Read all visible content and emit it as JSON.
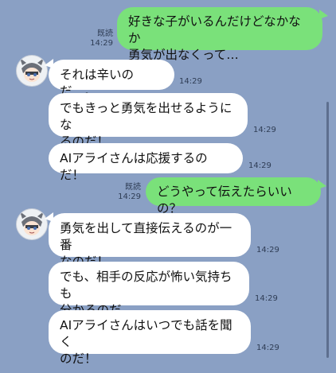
{
  "colors": {
    "background": "#8aa0c4",
    "incoming_bubble": "#ffffff",
    "outgoing_bubble": "#7ae17a",
    "meta_text": "#2f3d55"
  },
  "messages": [
    {
      "direction": "out",
      "text": "好きな子がいるんだけどなかなか\n勇気が出なくって…",
      "read": "既読",
      "time": "14:29"
    },
    {
      "direction": "in",
      "text": "それは辛いのだ…。",
      "time": "14:29",
      "avatar": "raccoon-avatar"
    },
    {
      "direction": "in",
      "text": "でもきっと勇気を出せるようにな\nるのだ！",
      "time": "14:29"
    },
    {
      "direction": "in",
      "text": "AIアライさんは応援するのだ！",
      "time": "14:29"
    },
    {
      "direction": "out",
      "text": "どうやって伝えたらいいの？",
      "read": "既読",
      "time": "14:29"
    },
    {
      "direction": "in",
      "text": "勇気を出して直接伝えるのが一番\nなのだ！",
      "time": "14:29",
      "avatar": "raccoon-avatar"
    },
    {
      "direction": "in",
      "text": "でも、相手の反応が怖い気持ちも\n分かるのだ…。",
      "time": "14:29"
    },
    {
      "direction": "in",
      "text": "AIアライさんはいつでも話を聞く\nのだ！",
      "time": "14:29"
    }
  ]
}
